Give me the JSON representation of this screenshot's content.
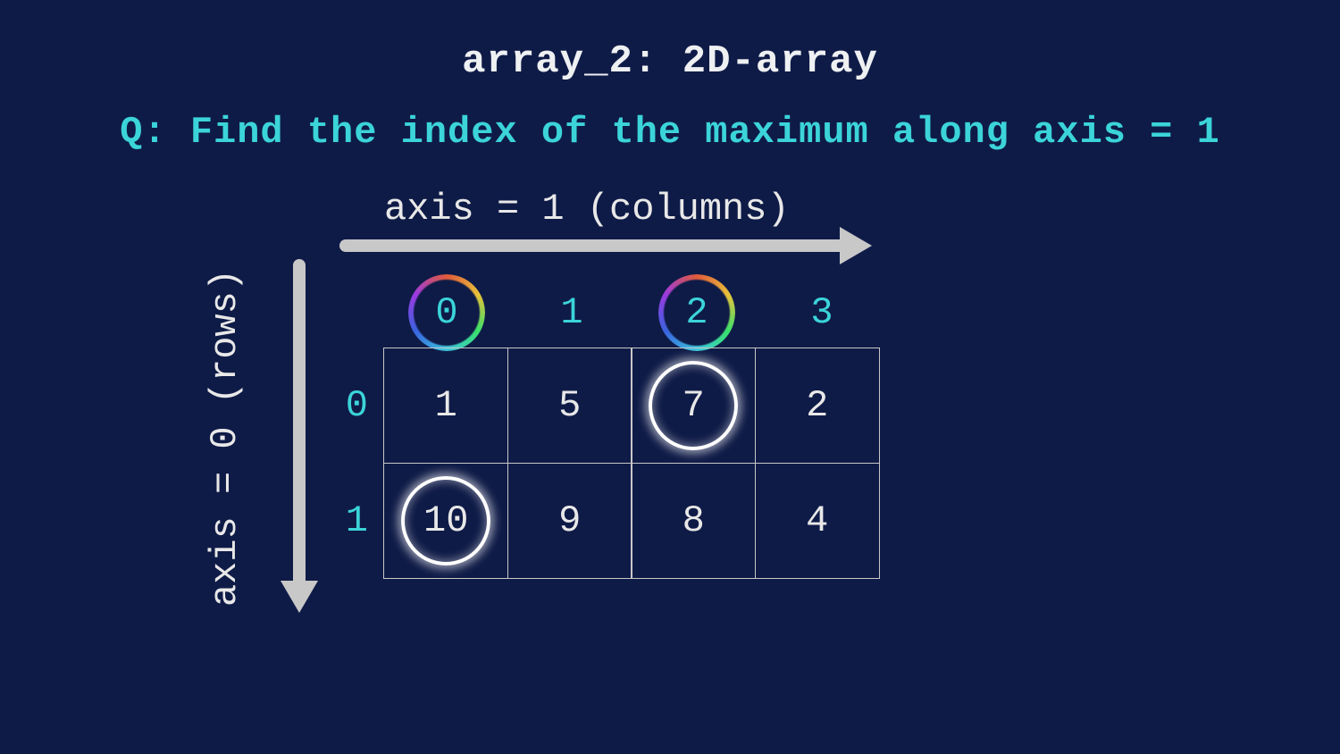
{
  "title": "array_2: 2D-array",
  "question": "Q: Find the index of the maximum along axis = 1",
  "axis1_label": "axis = 1 (columns)",
  "axis0_label": "axis = 0 (rows)",
  "columns": [
    "0",
    "1",
    "2",
    "3"
  ],
  "rows": [
    "0",
    "1"
  ],
  "cells": [
    [
      "1",
      "5",
      "7",
      "2"
    ],
    [
      "10",
      "9",
      "8",
      "4"
    ]
  ],
  "highlighted_column_indices": [
    0,
    2
  ],
  "highlighted_cells": [
    [
      0,
      2
    ],
    [
      1,
      0
    ]
  ]
}
